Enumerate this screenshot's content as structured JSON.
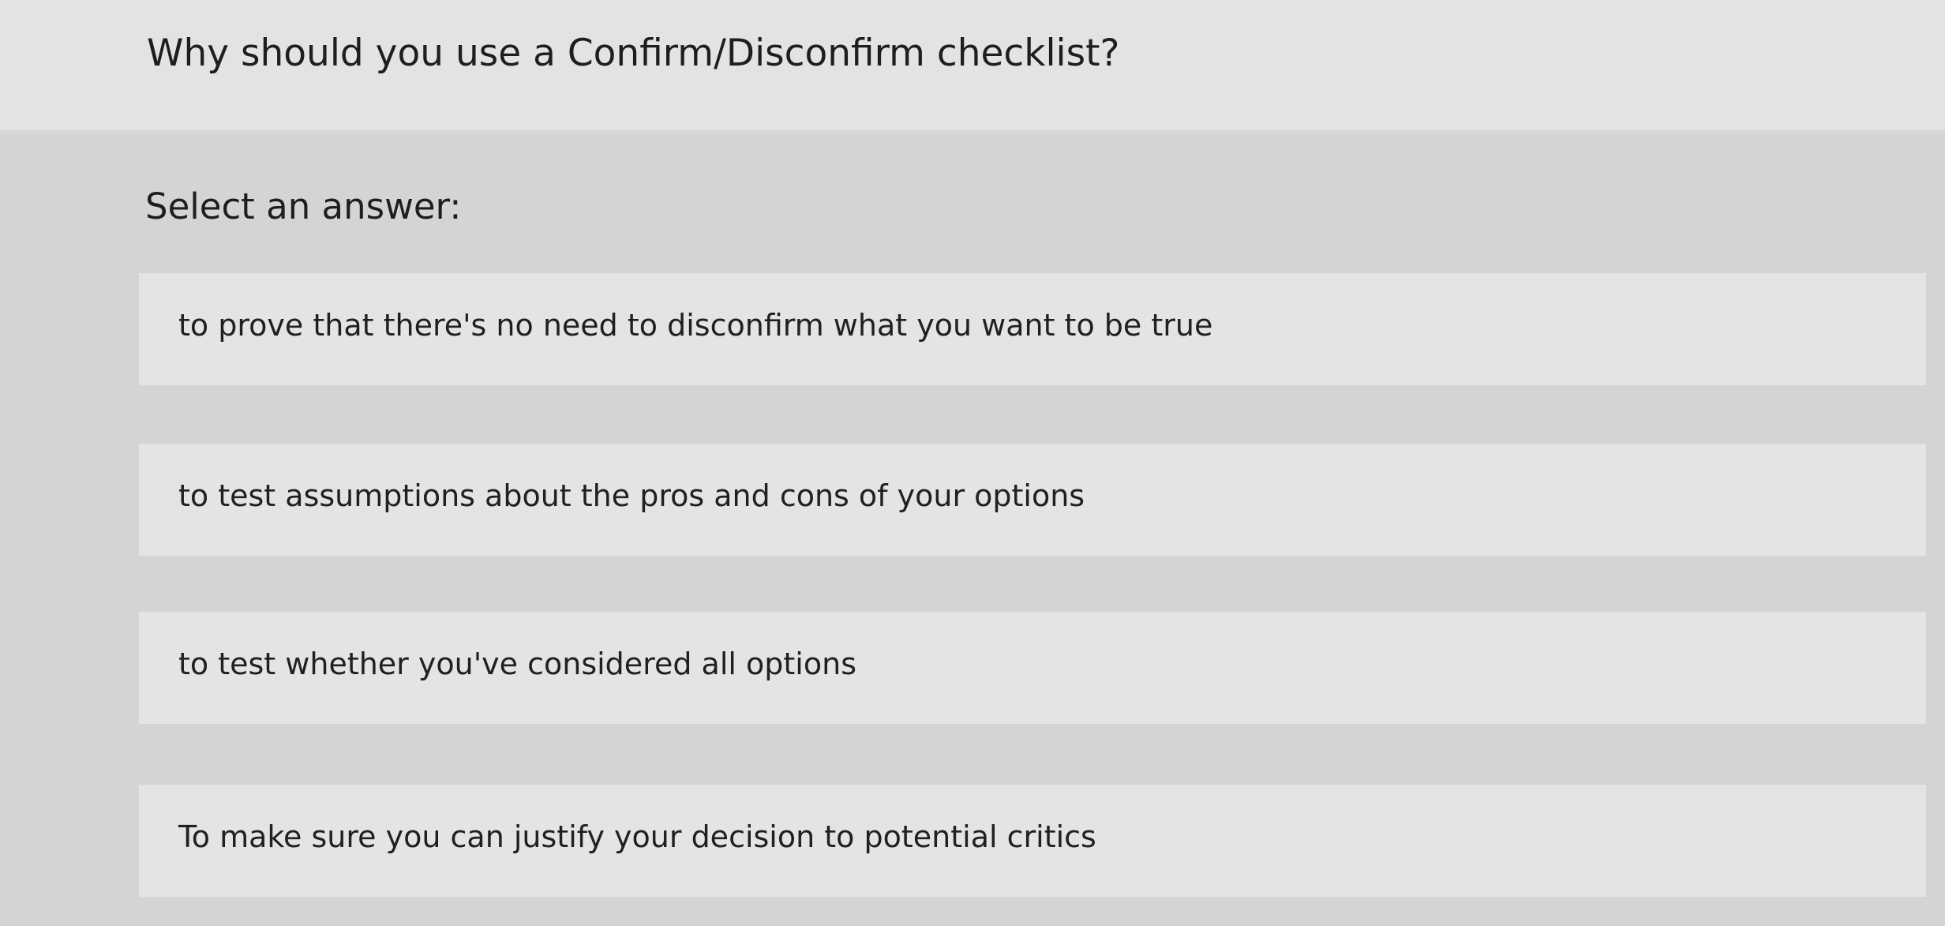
{
  "question": {
    "text": "Why should you use a Confirm/Disconfirm checklist?"
  },
  "answer_section": {
    "prompt": "Select an answer:",
    "options": [
      {
        "label": "to prove that there's no need to disconfirm what you want to be true"
      },
      {
        "label": "to test assumptions about the pros and cons of your options"
      },
      {
        "label": "to test whether you've considered all options"
      },
      {
        "label": "To make sure you can justify your decision to potential critics"
      }
    ]
  },
  "colors": {
    "question_band": "#e2e4e1",
    "answer_panel": "#d3d5d2",
    "option_background": "#e3e5e2",
    "text": "#1f1f1f"
  }
}
